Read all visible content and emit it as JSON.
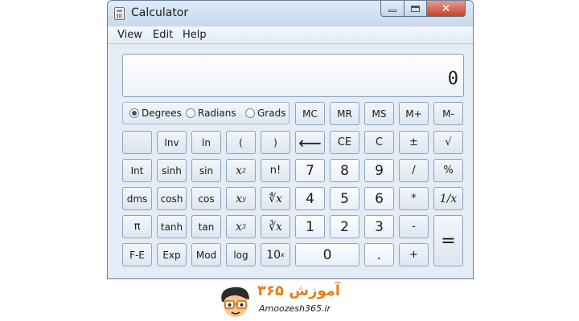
{
  "window": {
    "title": "Calculator",
    "close_glyph": "✕"
  },
  "menu": {
    "items": [
      "View",
      "Edit",
      "Help"
    ]
  },
  "display": {
    "value": "0"
  },
  "angle_mode": {
    "options": [
      "Degrees",
      "Radians",
      "Grads"
    ],
    "selected": "Degrees"
  },
  "memory_keys": [
    "MC",
    "MR",
    "MS",
    "M+",
    "M-"
  ],
  "keys": {
    "inv": "Inv",
    "ln": "ln",
    "lparen": "(",
    "rparen": ")",
    "backspace": "⟵",
    "ce": "CE",
    "c": "C",
    "plusminus": "±",
    "sqrt": "√",
    "int": "Int",
    "sinh": "sinh",
    "sin": "sin",
    "x2_base": "x",
    "x2_exp": "2",
    "fact": "n!",
    "n7": "7",
    "n8": "8",
    "n9": "9",
    "divide": "/",
    "percent": "%",
    "dms": "dms",
    "cosh": "cosh",
    "cos": "cos",
    "xy_base": "x",
    "xy_exp": "y",
    "yroot": "∜x",
    "n4": "4",
    "n5": "5",
    "n6": "6",
    "multiply": "*",
    "reciprocal": "1/x",
    "pi": "π",
    "tanh": "tanh",
    "tan": "tan",
    "x3_base": "x",
    "x3_exp": "3",
    "cuberoot": "∛x",
    "n1": "1",
    "n2": "2",
    "n3": "3",
    "minus": "-",
    "equals": "=",
    "fe": "F-E",
    "exp": "Exp",
    "mod": "Mod",
    "log": "log",
    "tenx_base": "10",
    "tenx_exp": "x",
    "n0": "0",
    "dot": ".",
    "plus": "+"
  },
  "logo": {
    "fa_text": "آموزش ۳۶۵",
    "en_text": "Amoozesh365.ir"
  },
  "colors": {
    "accent": "#e87d17",
    "close_button": "#c6432c"
  }
}
